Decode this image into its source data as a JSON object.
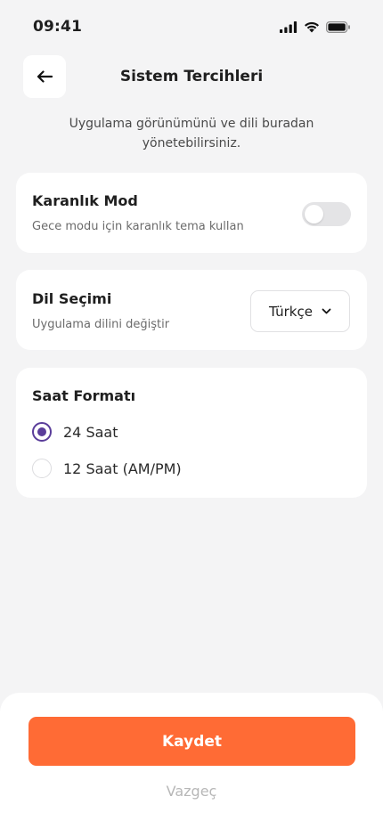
{
  "status_bar": {
    "time": "09:41"
  },
  "header": {
    "title": "Sistem Tercihleri"
  },
  "subtitle": "Uygulama görünümünü ve dili buradan yönetebilirsiniz.",
  "dark_mode": {
    "title": "Karanlık Mod",
    "description": "Gece modu için karanlık tema kullan",
    "enabled": false
  },
  "language": {
    "title": "Dil Seçimi",
    "description": "Uygulama dilini değiştir",
    "selected": "Türkçe"
  },
  "time_format": {
    "title": "Saat Formatı",
    "options": [
      {
        "label": "24 Saat",
        "selected": true
      },
      {
        "label": "12 Saat (AM/PM)",
        "selected": false
      }
    ]
  },
  "actions": {
    "save_label": "Kaydet",
    "cancel_label": "Vazgeç"
  },
  "colors": {
    "accent": "#ff6b35",
    "radio_selected": "#5a3d9a",
    "background": "#f4f4f5"
  }
}
